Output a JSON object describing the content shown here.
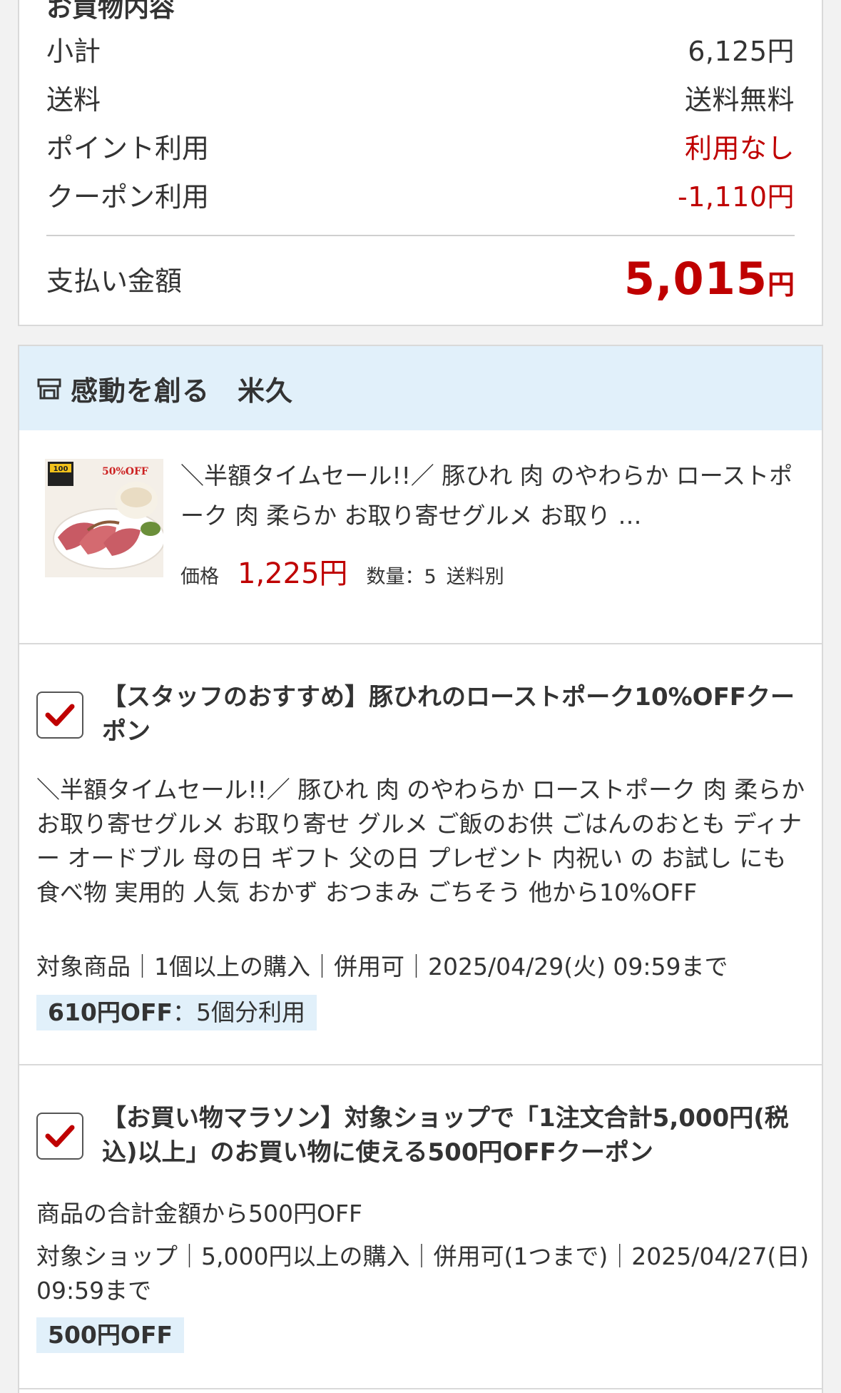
{
  "summary": {
    "heading": "お買物内容",
    "rows": [
      {
        "label": "小計",
        "value": "6,125円"
      },
      {
        "label": "送料",
        "value": "送料無料"
      },
      {
        "label": "ポイント利用",
        "value": "利用なし"
      },
      {
        "label": "クーポン利用",
        "value": "-1,110円"
      }
    ],
    "total_label": "支払い金額",
    "total_amount": "5,015",
    "total_unit": "円"
  },
  "shop": {
    "name": "感動を創る　米久",
    "item": {
      "title": "＼半額タイムセール!!／ 豚ひれ 肉 のやわらか ローストポーク 肉 柔らか お取り寄せグルメ お取り …",
      "price_label": "価格",
      "price": "1,225円",
      "qty_label": "数量：5",
      "shipping": "送料別",
      "thumb_badge_top": "100",
      "thumb_badge_off": "50%OFF"
    },
    "coupons": [
      {
        "checked": true,
        "title": "【スタッフのおすすめ】豚ひれのローストポーク10%OFFクーポン",
        "description": "＼半額タイムセール!!／ 豚ひれ 肉 のやわらか ローストポーク 肉 柔らか お取り寄せグルメ お取り寄せ グルメ ご飯のお供 ごはんのおとも ディナー オードブル 母の日 ギフト 父の日 プレゼント 内祝い の お試し にも 食べ物 実用的 人気 おかず おつまみ ごちそう 他から10%OFF",
        "conditions": "対象商品｜1個以上の購入｜併用可｜2025/04/29(火) 09:59まで",
        "off": "610円OFF",
        "off_note": "：5個分利用"
      },
      {
        "checked": true,
        "title": "【お買い物マラソン】対象ショップで「1注文合計5,000円(税込)以上」のお買い物に使える500円OFFクーポン",
        "description": "商品の合計金額から500円OFF",
        "conditions": "対象ショップ｜5,000円以上の購入｜併用可(1つまで)｜2025/04/27(日) 09:59まで",
        "off": "500円OFF",
        "off_note": ""
      }
    ]
  },
  "colors": {
    "accent_red": "#bf0000",
    "header_bg": "#e1f0fa",
    "check_red": "#bf0000"
  }
}
